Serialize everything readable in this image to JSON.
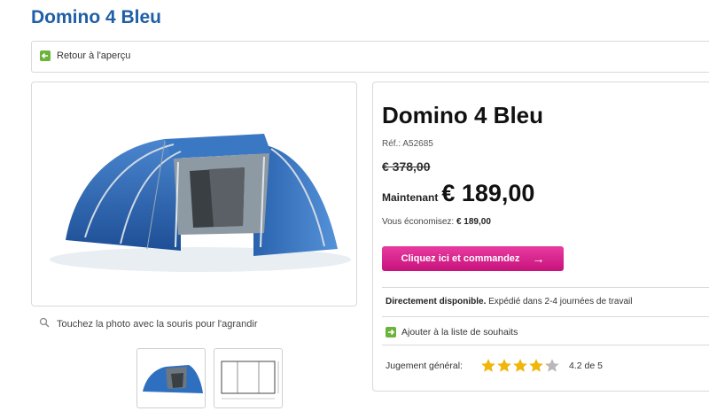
{
  "page": {
    "title": "Domino 4 Bleu"
  },
  "nav": {
    "back_label": "Retour à l'aperçu"
  },
  "gallery": {
    "zoom_hint": "Touchez la photo avec la souris pour l'agrandir",
    "thumbnails": [
      "tent-photo",
      "tent-floorplan"
    ]
  },
  "product": {
    "name": "Domino 4 Bleu",
    "ref": "Réf.: A52685",
    "old_price": "€ 378,00",
    "now_label": "Maintenant",
    "now_price": "€ 189,00",
    "savings_label": "Vous économisez:",
    "savings_value": "€ 189,00",
    "order_button": "Cliquez ici et commandez",
    "availability_bold": "Directement disponible.",
    "availability_text": " Expédié dans 2-4 journées de travail",
    "wishlist_label": "Ajouter à la liste de souhaits",
    "rating_label": "Jugement général:",
    "rating_value": 4.2,
    "rating_text": "4.2 de 5"
  },
  "colors": {
    "title": "#1f5fa8",
    "cta": "#d4218b",
    "star": "#f2b705",
    "icon_green": "#6bb33a"
  }
}
